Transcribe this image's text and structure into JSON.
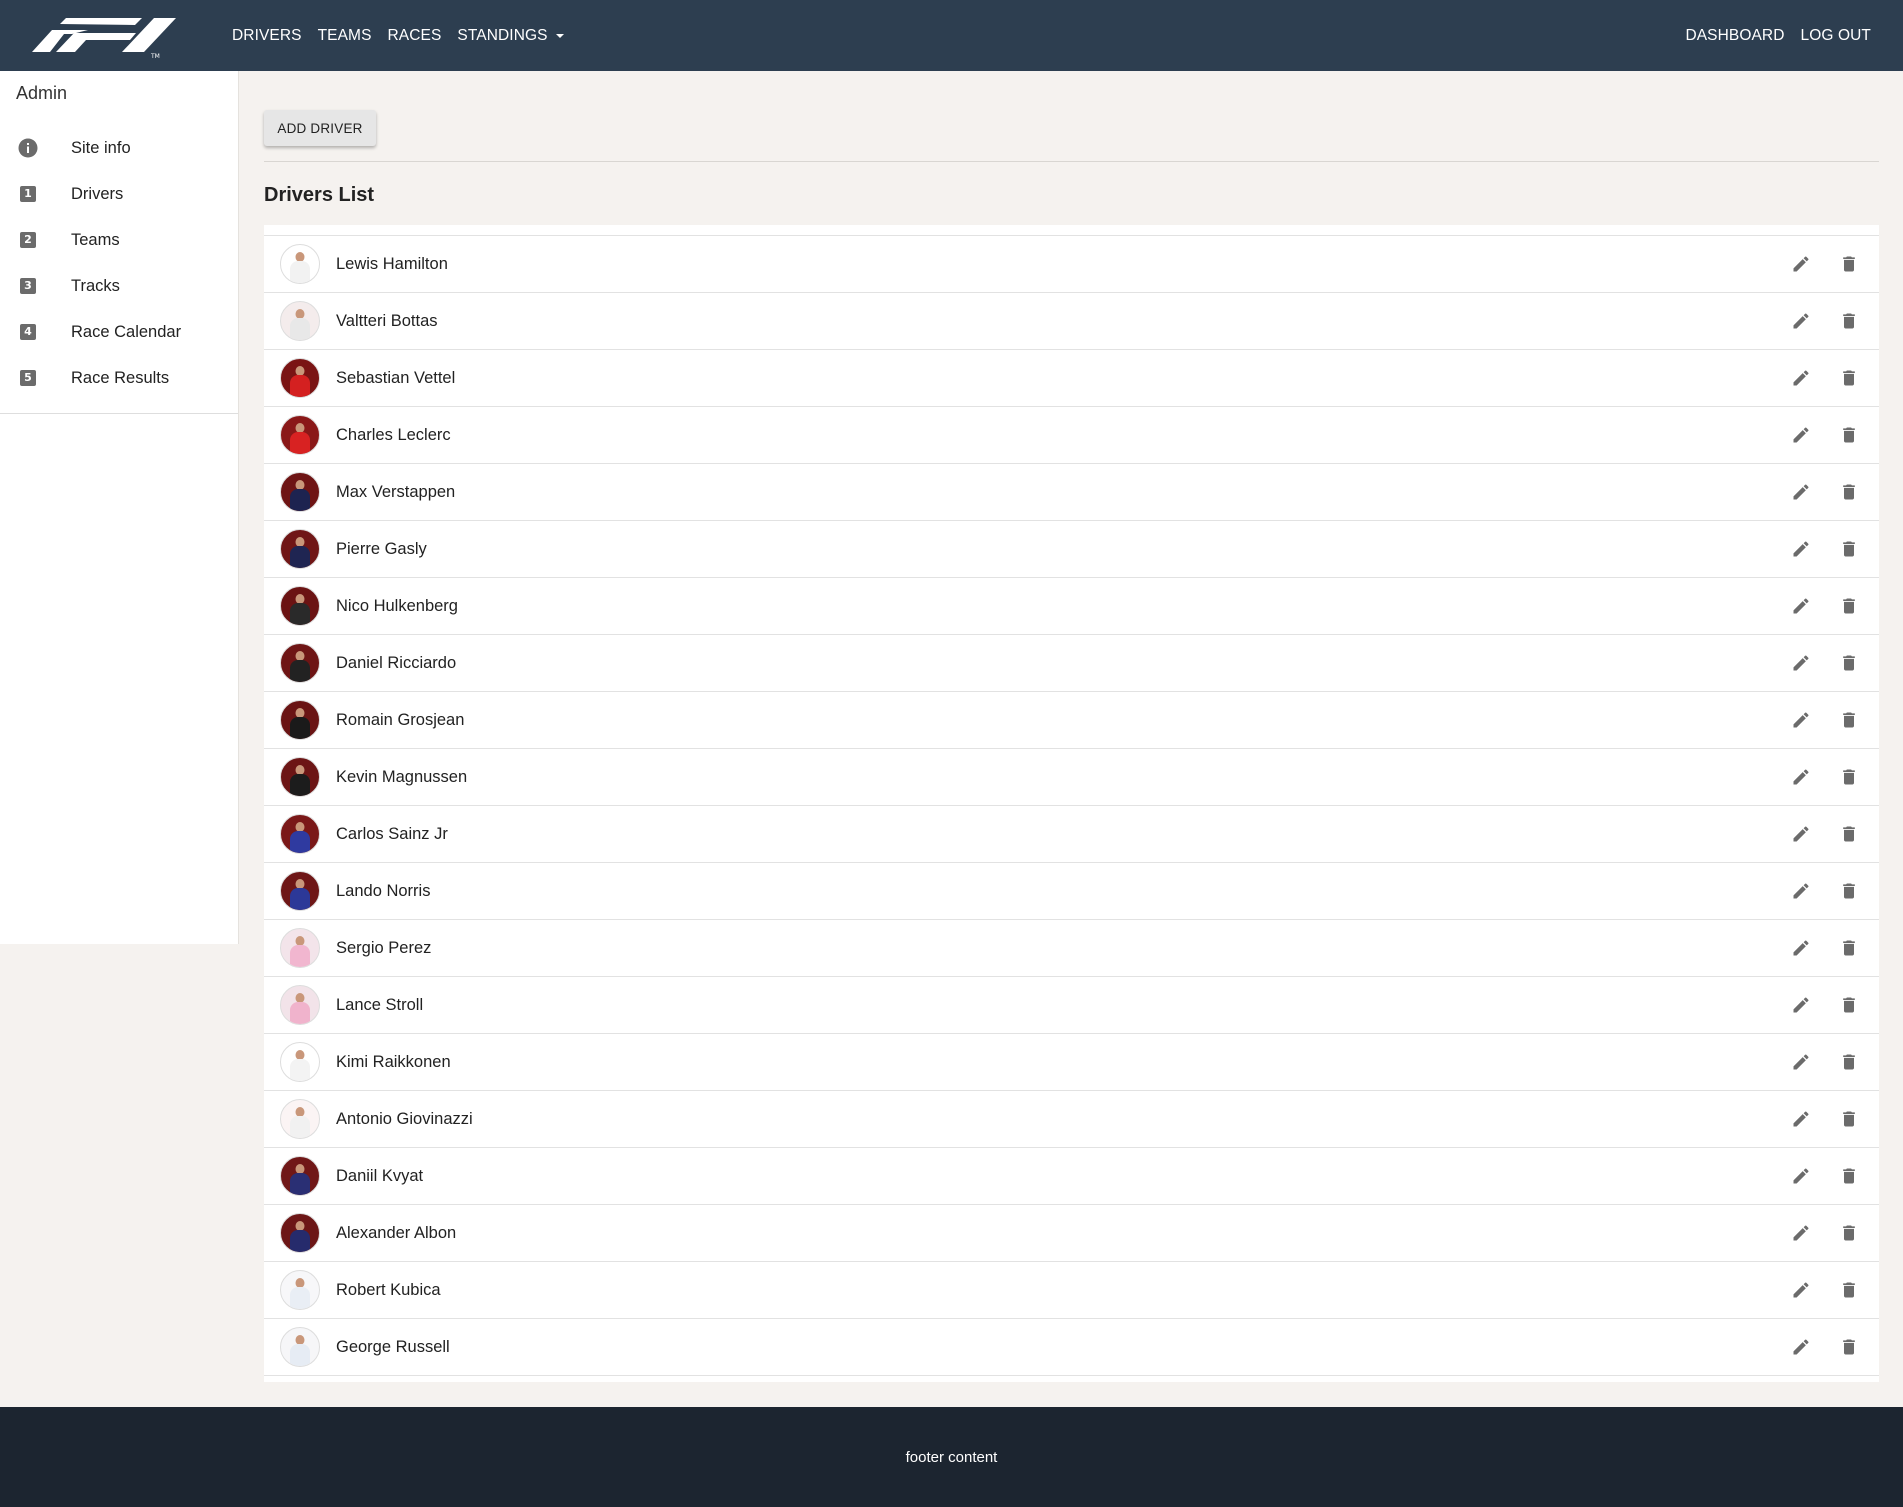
{
  "header": {
    "nav": [
      "DRIVERS",
      "TEAMS",
      "RACES",
      "STANDINGS"
    ],
    "nav_right": [
      "DASHBOARD",
      "LOG OUT"
    ]
  },
  "sidebar": {
    "title": "Admin",
    "items": [
      {
        "label": "Site info",
        "icon": "info-icon"
      },
      {
        "label": "Drivers",
        "icon": "looks-one-icon"
      },
      {
        "label": "Teams",
        "icon": "looks-two-icon"
      },
      {
        "label": "Tracks",
        "icon": "looks-three-icon"
      },
      {
        "label": "Race Calendar",
        "icon": "looks-four-icon"
      },
      {
        "label": "Race Results",
        "icon": "looks-five-icon"
      }
    ]
  },
  "main": {
    "add_button": "ADD DRIVER",
    "list_title": "Drivers List",
    "drivers": [
      {
        "name": "Lewis Hamilton",
        "suit": "#f2f2f2",
        "bg": "#ffffff"
      },
      {
        "name": "Valtteri Bottas",
        "suit": "#e8e8e8",
        "bg": "#f4ecec"
      },
      {
        "name": "Sebastian Vettel",
        "suit": "#d42020",
        "bg": "#7a1414"
      },
      {
        "name": "Charles Leclerc",
        "suit": "#d82222",
        "bg": "#8a1818"
      },
      {
        "name": "Max Verstappen",
        "suit": "#1d2350",
        "bg": "#6e1414"
      },
      {
        "name": "Pierre Gasly",
        "suit": "#1f2552",
        "bg": "#701616"
      },
      {
        "name": "Nico Hulkenberg",
        "suit": "#2a2a2a",
        "bg": "#6b1313"
      },
      {
        "name": "Daniel Ricciardo",
        "suit": "#222222",
        "bg": "#6e1515"
      },
      {
        "name": "Romain Grosjean",
        "suit": "#1a1a1a",
        "bg": "#6a1414"
      },
      {
        "name": "Kevin Magnussen",
        "suit": "#1c1c1c",
        "bg": "#6c1515"
      },
      {
        "name": "Carlos Sainz Jr",
        "suit": "#2f3aa0",
        "bg": "#7a1818"
      },
      {
        "name": "Lando Norris",
        "suit": "#2c3898",
        "bg": "#6e1616"
      },
      {
        "name": "Sergio Perez",
        "suit": "#f1b6cf",
        "bg": "#f3e4ea"
      },
      {
        "name": "Lance Stroll",
        "suit": "#f0b3cc",
        "bg": "#f2e3e9"
      },
      {
        "name": "Kimi Raikkonen",
        "suit": "#f3f3f3",
        "bg": "#ffffff"
      },
      {
        "name": "Antonio Giovinazzi",
        "suit": "#f1f1f1",
        "bg": "#fbf4f4"
      },
      {
        "name": "Daniil Kvyat",
        "suit": "#2a2f74",
        "bg": "#701717"
      },
      {
        "name": "Alexander Albon",
        "suit": "#262b6c",
        "bg": "#6c1616"
      },
      {
        "name": "Robert Kubica",
        "suit": "#e9eef5",
        "bg": "#f7f7f9"
      },
      {
        "name": "George Russell",
        "suit": "#e6ecf4",
        "bg": "#f6f6f8"
      }
    ]
  },
  "footer": {
    "text": "footer content"
  },
  "colors": {
    "header_bg": "#2d3e50",
    "footer_bg": "#1c2530",
    "page_bg": "#f5f2ef",
    "icon_grey": "#6b6b6b"
  }
}
